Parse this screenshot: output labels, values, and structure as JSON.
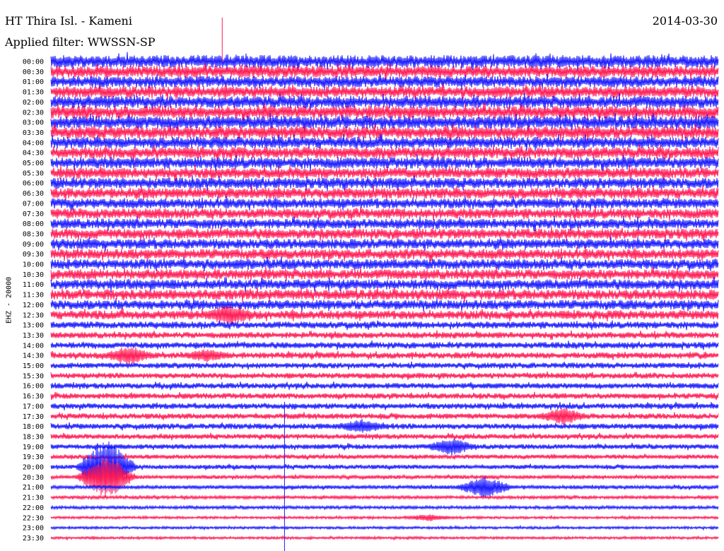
{
  "header": {
    "station": "HT Thira Isl. - Kameni",
    "date": "2014-03-30",
    "filter": "Applied filter: WWSSN-SP",
    "channel": "EHZ - 20000"
  },
  "colors": {
    "trace_a": "#1a1aff",
    "trace_b": "#ff1a55"
  },
  "chart_data": {
    "type": "line",
    "title": "HT Thira Isl. - Kameni",
    "subtitle": "Applied filter: WWSSN-SP",
    "ylabel": "EHZ - 20000",
    "row_labels": [
      "00:00",
      "00:30",
      "01:00",
      "01:30",
      "02:00",
      "02:30",
      "03:00",
      "03:30",
      "04:00",
      "04:30",
      "05:00",
      "05:30",
      "06:00",
      "06:30",
      "07:00",
      "07:30",
      "08:00",
      "08:30",
      "09:00",
      "09:30",
      "10:00",
      "10:30",
      "11:00",
      "11:30",
      "12:00",
      "12:30",
      "13:00",
      "13:30",
      "14:00",
      "14:30",
      "15:00",
      "15:30",
      "16:00",
      "16:30",
      "17:00",
      "17:30",
      "18:00",
      "18:30",
      "19:00",
      "19:30",
      "20:00",
      "20:30",
      "21:00",
      "21:30",
      "22:00",
      "22:30",
      "23:00",
      "23:30"
    ],
    "row_color_cycle": [
      "trace_a",
      "trace_b"
    ],
    "noise_amplitude": [
      1.0,
      0.95,
      0.9,
      0.9,
      0.95,
      1.0,
      1.0,
      1.0,
      0.9,
      0.9,
      0.9,
      0.85,
      0.85,
      0.85,
      0.8,
      0.8,
      0.8,
      0.8,
      0.8,
      0.8,
      0.8,
      0.8,
      0.8,
      0.8,
      0.75,
      0.7,
      0.55,
      0.5,
      0.5,
      0.5,
      0.45,
      0.45,
      0.45,
      0.45,
      0.45,
      0.45,
      0.45,
      0.4,
      0.4,
      0.35,
      0.35,
      0.3,
      0.3,
      0.25,
      0.25,
      0.2,
      0.2,
      0.2
    ],
    "events": [
      {
        "row": "12:30",
        "minute": 8.0,
        "amplitude": 1.8
      },
      {
        "row": "14:30",
        "minute": 3.5,
        "amplitude": 1.6
      },
      {
        "row": "14:30",
        "minute": 7.0,
        "amplitude": 1.1
      },
      {
        "row": "18:00",
        "minute": 14.0,
        "amplitude": 1.2
      },
      {
        "row": "17:30",
        "minute": 23.0,
        "amplitude": 1.4
      },
      {
        "row": "19:00",
        "minute": 18.0,
        "amplitude": 1.4
      },
      {
        "row": "20:00",
        "minute": 2.5,
        "amplitude": 4.5
      },
      {
        "row": "20:30",
        "minute": 2.5,
        "amplitude": 3.5
      },
      {
        "row": "21:00",
        "minute": 19.5,
        "amplitude": 1.8
      },
      {
        "row": "22:30",
        "minute": 17.0,
        "amplitude": 0.6
      }
    ],
    "marker_lines": [
      {
        "color": "trace_b",
        "minute": 7.7,
        "from_row": 0
      },
      {
        "color": "trace_a",
        "minute": 10.5,
        "from_row": 34
      }
    ]
  }
}
